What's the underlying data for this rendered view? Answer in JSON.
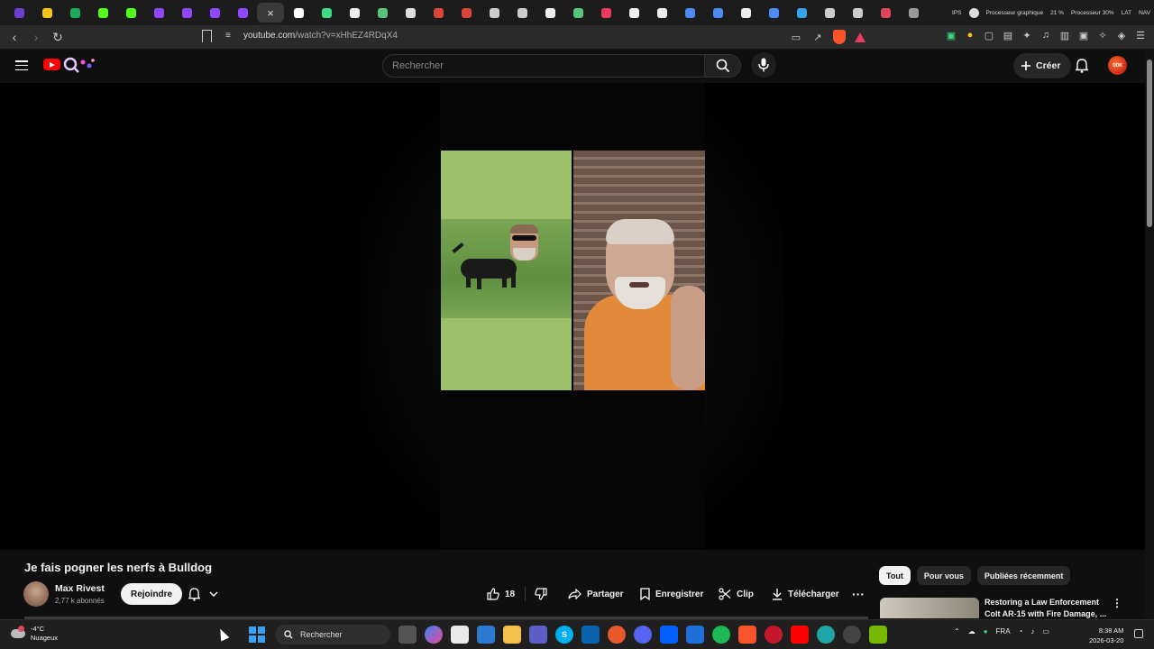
{
  "browser": {
    "tab_favicons": [
      {
        "color": "#6c3fd1"
      },
      {
        "color": "#f5c518"
      },
      {
        "color": "#1faa59"
      },
      {
        "color": "#53fc18"
      },
      {
        "color": "#53fc18"
      },
      {
        "color": "#9146ff"
      },
      {
        "color": "#9146ff"
      },
      {
        "color": "#9146ff"
      },
      {
        "color": "#9146ff"
      },
      {
        "color": "#ff0000"
      },
      {
        "color": "#ffffff"
      },
      {
        "color": "#3ddc84"
      },
      {
        "color": "#eeeeee"
      },
      {
        "color": "#55c57a"
      },
      {
        "color": "#dddddd"
      },
      {
        "color": "#db4437"
      },
      {
        "color": "#db4437"
      },
      {
        "color": "#cccccc"
      },
      {
        "color": "#cccccc"
      },
      {
        "color": "#eeeeee"
      },
      {
        "color": "#55c57a"
      },
      {
        "color": "#e83c5a"
      },
      {
        "color": "#eeeeee"
      },
      {
        "color": "#eeeeee"
      },
      {
        "color": "#4c8bf5"
      },
      {
        "color": "#4c8bf5"
      },
      {
        "color": "#eeeeee"
      },
      {
        "color": "#4c8bf5"
      },
      {
        "color": "#36a2eb"
      },
      {
        "color": "#cccccc"
      },
      {
        "color": "#cccccc"
      },
      {
        "color": "#e0455a"
      },
      {
        "color": "#999999"
      }
    ],
    "sys": {
      "label_ips": "IPS",
      "label_gpu": "Processeur graphique",
      "pct": "21 %",
      "label_cpu": "Processeur 30%",
      "label_lat": "LAT",
      "label_nav": "NAV"
    },
    "url_host": "youtube.com",
    "url_path": "/watch?v=xHhEZ4RDqX4"
  },
  "header": {
    "search_placeholder": "Rechercher",
    "create_label": "Créer",
    "avatar_text": "DDK"
  },
  "video": {
    "title": "Je fais pogner les nerfs à Bulldog",
    "channel": "Max Rivest",
    "subscribers": "2,77 k abonnés",
    "join_label": "Rejoindre",
    "likes": "18",
    "share_label": "Partager",
    "save_label": "Enregistrer",
    "clip_label": "Clip",
    "download_label": "Télécharger",
    "more_label": "···"
  },
  "sidebar": {
    "chips": [
      "Tout",
      "Pour vous",
      "Publiées récemment"
    ],
    "rec_title": "Restoring a Law Enforcement Colt AR-15 with Fire Damage, ...",
    "rec_more": "⋮"
  },
  "taskbar": {
    "temp": "-4°C",
    "weather": "Nuageux",
    "search_label": "Rechercher",
    "lang": "FRA",
    "time": "8:38 AM",
    "date": "2026-03-20"
  }
}
